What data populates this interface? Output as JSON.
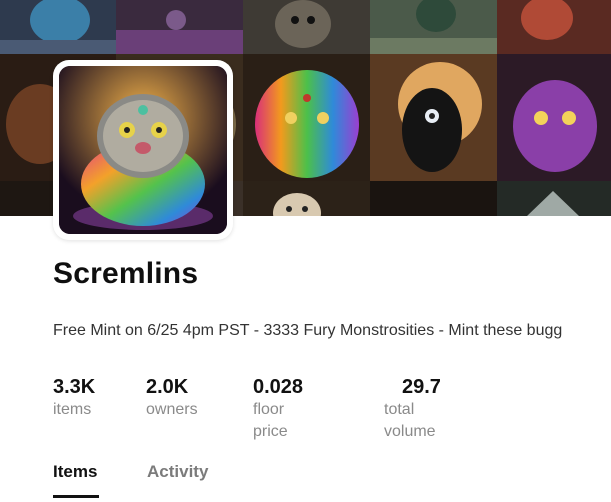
{
  "collection": {
    "name": "Scremlins",
    "description": "Free Mint on 6/25 4pm PST - 3333 Fury Monstrosities - Mint these bugg"
  },
  "stats": [
    {
      "value": "3.3K",
      "label": "items"
    },
    {
      "value": "2.0K",
      "label": "owners"
    },
    {
      "value": "0.028",
      "label": "floor price"
    },
    {
      "value": "29.7",
      "label": "total volume"
    }
  ],
  "tabs": [
    {
      "label": "Items",
      "active": true
    },
    {
      "label": "Activity",
      "active": false
    }
  ],
  "colors": {
    "text_primary": "#111111",
    "text_secondary": "#8a8a8a",
    "tab_inactive": "#7b7b7b",
    "background": "#ffffff"
  },
  "images": {
    "banner": "banner-collage",
    "avatar": "collection-avatar"
  }
}
